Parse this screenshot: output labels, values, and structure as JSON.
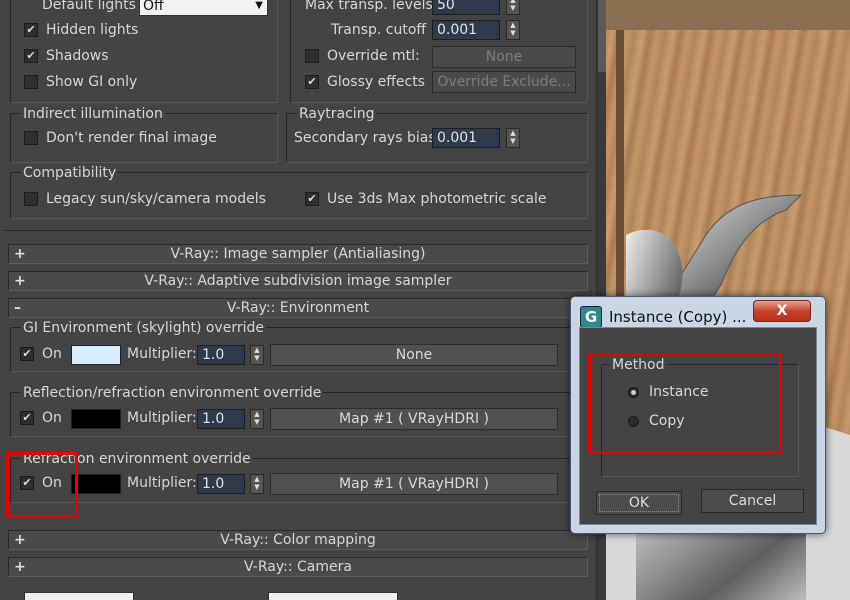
{
  "top_section": {
    "default_lights_label": "Default lights",
    "default_lights_value": "Off",
    "hidden_lights": {
      "label": "Hidden lights",
      "checked": true
    },
    "shadows": {
      "label": "Shadows",
      "checked": true
    },
    "show_gi_only": {
      "label": "Show GI only",
      "checked": false
    },
    "max_transp_levels_label": "Max transp. levels",
    "max_transp_levels_value": "50",
    "transp_cutoff_label": "Transp. cutoff",
    "transp_cutoff_value": "0.001",
    "override_mtl": {
      "label": "Override mtl:",
      "checked": false,
      "button": "None"
    },
    "glossy_effects": {
      "label": "Glossy effects",
      "checked": true,
      "button": "Override Exclude..."
    }
  },
  "indirect": {
    "title": "Indirect illumination",
    "dont_render_final": {
      "label": "Don't render final image",
      "checked": false
    }
  },
  "raytracing": {
    "title": "Raytracing",
    "secondary_bias_label": "Secondary rays bias",
    "secondary_bias_value": "0.001"
  },
  "compatibility": {
    "title": "Compatibility",
    "legacy": {
      "label": "Legacy sun/sky/camera models",
      "checked": false
    },
    "photometric": {
      "label": "Use 3ds Max photometric scale",
      "checked": true
    }
  },
  "rollouts": {
    "image_sampler": {
      "sign": "+",
      "title": "V-Ray:: Image sampler (Antialiasing)"
    },
    "adaptive": {
      "sign": "+",
      "title": "V-Ray:: Adaptive subdivision image sampler"
    },
    "environment": {
      "sign": "–",
      "title": "V-Ray:: Environment"
    },
    "color_mapping": {
      "sign": "+",
      "title": "V-Ray:: Color mapping"
    },
    "camera": {
      "sign": "+",
      "title": "V-Ray:: Camera"
    }
  },
  "environment": {
    "gi": {
      "title": "GI Environment (skylight) override",
      "on_label": "On",
      "on_checked": true,
      "swatch_color": "#d6ecff",
      "multiplier_label": "Multiplier:",
      "multiplier_value": "1.0",
      "map_button": "None"
    },
    "reflection": {
      "title": "Reflection/refraction environment override",
      "on_label": "On",
      "on_checked": true,
      "swatch_color": "#000000",
      "multiplier_label": "Multiplier:",
      "multiplier_value": "1.0",
      "map_button": "Map #1  ( VRayHDRI )"
    },
    "refraction": {
      "title": "Refraction environment override",
      "on_label": "On",
      "on_checked": true,
      "swatch_color": "#000000",
      "multiplier_label": "Multiplier:",
      "multiplier_value": "1.0",
      "map_button": "Map #1  ( VRayHDRI )"
    }
  },
  "dialog": {
    "title": "Instance (Copy) ...",
    "icon_letter": "G",
    "close_label": "X",
    "method_title": "Method",
    "options": [
      {
        "label": "Instance",
        "selected": true
      },
      {
        "label": "Copy",
        "selected": false
      }
    ],
    "ok_label": "OK",
    "cancel_label": "Cancel"
  },
  "colors": {
    "panel_bg": "#444444",
    "highlight_red": "#ee0000",
    "dialog_frame": "#c9d6e6"
  }
}
